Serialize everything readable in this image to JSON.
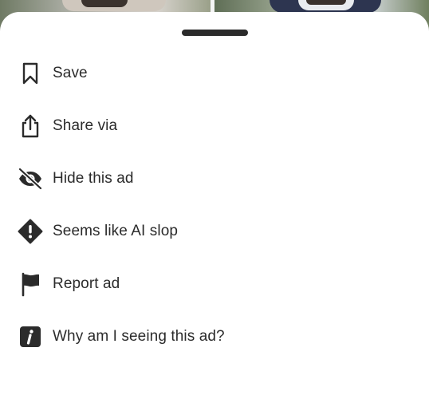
{
  "menu": {
    "items": [
      {
        "label": "Save",
        "icon": "bookmark-icon"
      },
      {
        "label": "Share via",
        "icon": "share-icon"
      },
      {
        "label": "Hide this ad",
        "icon": "eye-slash-icon"
      },
      {
        "label": "Seems like AI slop",
        "icon": "warning-diamond-icon"
      },
      {
        "label": "Report ad",
        "icon": "flag-icon"
      },
      {
        "label": "Why am I seeing this ad?",
        "icon": "info-icon"
      }
    ]
  },
  "colors": {
    "text": "#2b2b2b",
    "sheet_background": "#ffffff",
    "grabber": "#2b2b2b"
  }
}
